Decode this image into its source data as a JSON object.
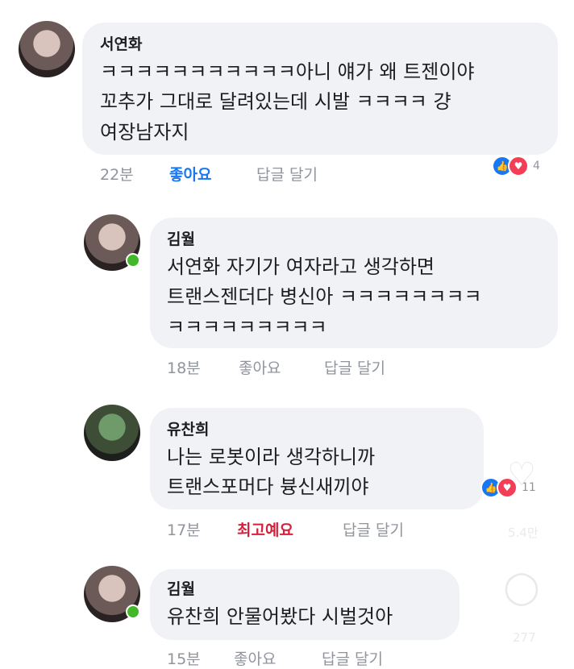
{
  "comments": [
    {
      "name": "서연화",
      "lines": [
        "ㅋㅋㅋㅋㅋㅋㅋㅋㅋㅋㅋ아니 얘가 왜 트젠이야",
        "꼬추가 그대로 달려있는데 시발 ㅋㅋㅋㅋ 걍",
        "여장남자지"
      ],
      "time": "22분",
      "like": "좋아요",
      "reply": "답글 달기",
      "reaction_count": "4"
    },
    {
      "name": "김월",
      "lines": [
        "서연화 자기가 여자라고 생각하면",
        "트랜스젠더다 병신아 ㅋㅋㅋㅋㅋㅋㅋㅋ",
        "ㅋㅋㅋㅋㅋㅋㅋㅋㅋ"
      ],
      "time": "18분",
      "like": "좋아요",
      "reply": "답글 달기"
    },
    {
      "name": "유찬희",
      "lines": [
        "나는 로봇이라 생각하니까",
        "트랜스포머다 븅신새끼야"
      ],
      "time": "17분",
      "like": "최고예요",
      "reply": "답글 달기",
      "reaction_count": "11"
    },
    {
      "name": "김월",
      "lines": [
        "유찬희 안물어봤다 시벌것아"
      ],
      "time": "15분",
      "like": "좋아요",
      "reply": "답글 달기"
    }
  ],
  "overlay": {
    "heart_count": "5.4만",
    "comment_count": "277"
  },
  "colors": {
    "bubble": "#f0f2f5",
    "like_active": "#1877f2",
    "like_best": "#d6203c",
    "online": "#42b72a"
  }
}
